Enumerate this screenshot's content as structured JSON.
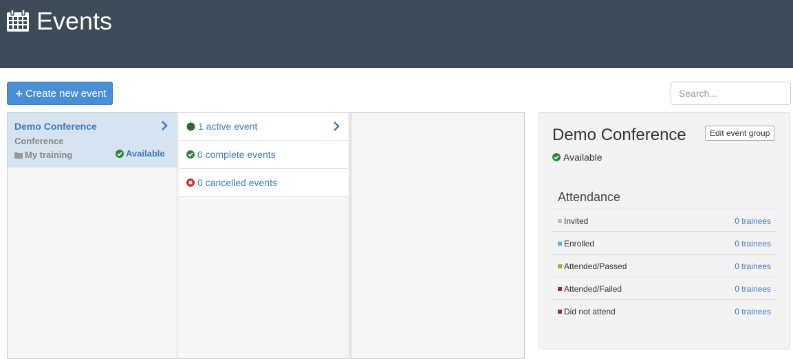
{
  "header": {
    "title": "Events"
  },
  "toolbar": {
    "create_label": "Create new event",
    "search_placeholder": "Search..."
  },
  "groups": [
    {
      "name": "Demo Conference",
      "type": "Conference",
      "folder": "My training",
      "status": "Available"
    }
  ],
  "statuses": [
    {
      "label": "1 active event",
      "icon": "active-dot-icon"
    },
    {
      "label": "0 complete events",
      "icon": "check-circle-icon"
    },
    {
      "label": "0 cancelled events",
      "icon": "x-circle-icon"
    }
  ],
  "detail": {
    "title": "Demo Conference",
    "edit_label": "Edit event group",
    "status": "Available",
    "attendance_title": "Attendance",
    "attendance": [
      {
        "label": "Invited",
        "count": "0 trainees",
        "color": "#c0c0c0"
      },
      {
        "label": "Enrolled",
        "count": "0 trainees",
        "color": "#5bb0de"
      },
      {
        "label": "Attended/Passed",
        "count": "0 trainees",
        "color": "#8dbb3e"
      },
      {
        "label": "Attended/Failed",
        "count": "0 trainees",
        "color": "#a0303a"
      },
      {
        "label": "Did not attend",
        "count": "0 trainees",
        "color": "#a0303a"
      }
    ]
  },
  "colors": {
    "header_bg": "#3c4b57",
    "accent": "#4a8fd6",
    "link": "#3d7ac0",
    "success": "#2e8540",
    "danger": "#b33a3a"
  }
}
